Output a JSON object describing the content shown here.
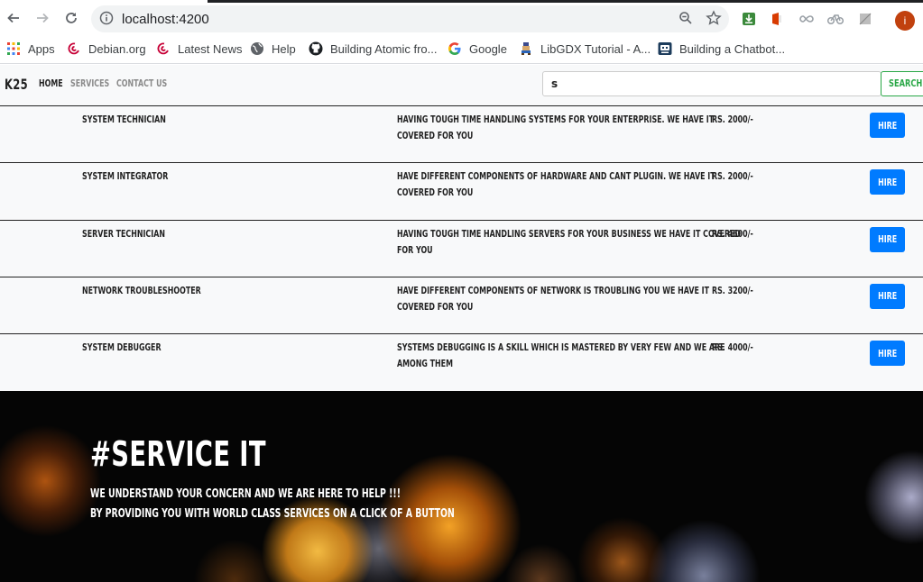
{
  "browser": {
    "url": "localhost:4200",
    "avatar_letter": "i",
    "bookmarks": [
      {
        "label": "Apps",
        "icon": "apps-grid-icon"
      },
      {
        "label": "Debian.org",
        "icon": "debian-icon"
      },
      {
        "label": "Latest News",
        "icon": "debian-icon"
      },
      {
        "label": "Help",
        "icon": "globe-icon"
      },
      {
        "label": "Building Atomic fro...",
        "icon": "github-icon"
      },
      {
        "label": "Google",
        "icon": "google-icon"
      },
      {
        "label": "LibGDX Tutorial - A...",
        "icon": "sprite-icon"
      },
      {
        "label": "Building a Chatbot...",
        "icon": "chatbot-icon"
      }
    ]
  },
  "navbar": {
    "brand": "K25",
    "links": [
      {
        "label": "Home",
        "active": true
      },
      {
        "label": "Services",
        "active": false
      },
      {
        "label": "Contact Us",
        "active": false
      }
    ],
    "search_value": "s",
    "search_button": "Search"
  },
  "services": [
    {
      "name": "System Technician",
      "desc_line1": "Having tough time handling systems for your enterprise. We have it",
      "desc_line2": "covered for you",
      "price": "Rs. 2000/-",
      "action": "Hire"
    },
    {
      "name": "System Integrator",
      "desc_line1": "Have different components of hardware and cant plugin. We have it",
      "desc_line2": "covered for you",
      "price": "Rs. 2000/-",
      "action": "Hire"
    },
    {
      "name": "Server Technician",
      "desc_line1": "Having tough time handling servers for your business we have it covered",
      "desc_line2": "for you",
      "price": "Rs. 4600/-",
      "action": "Hire"
    },
    {
      "name": "Network Troubleshooter",
      "desc_line1": "Have different components of network is troubling you we have it",
      "desc_line2": "covered for you",
      "price": "Rs. 3200/-",
      "action": "Hire"
    },
    {
      "name": "System Debugger",
      "desc_line1": "Systems debugging is a skill which is mastered by very few and we are",
      "desc_line2": "among them",
      "price": "Rs. 4000/-",
      "action": "Hire"
    }
  ],
  "hero": {
    "title": "#Service IT",
    "line1": "We understand your concern and we are here to help !!!",
    "line2": "By providing you with world class services on a click of a button"
  },
  "colors": {
    "primary": "#007bff",
    "success": "#28a745",
    "navbar_bg": "#f8f9fa",
    "text": "#222222"
  }
}
